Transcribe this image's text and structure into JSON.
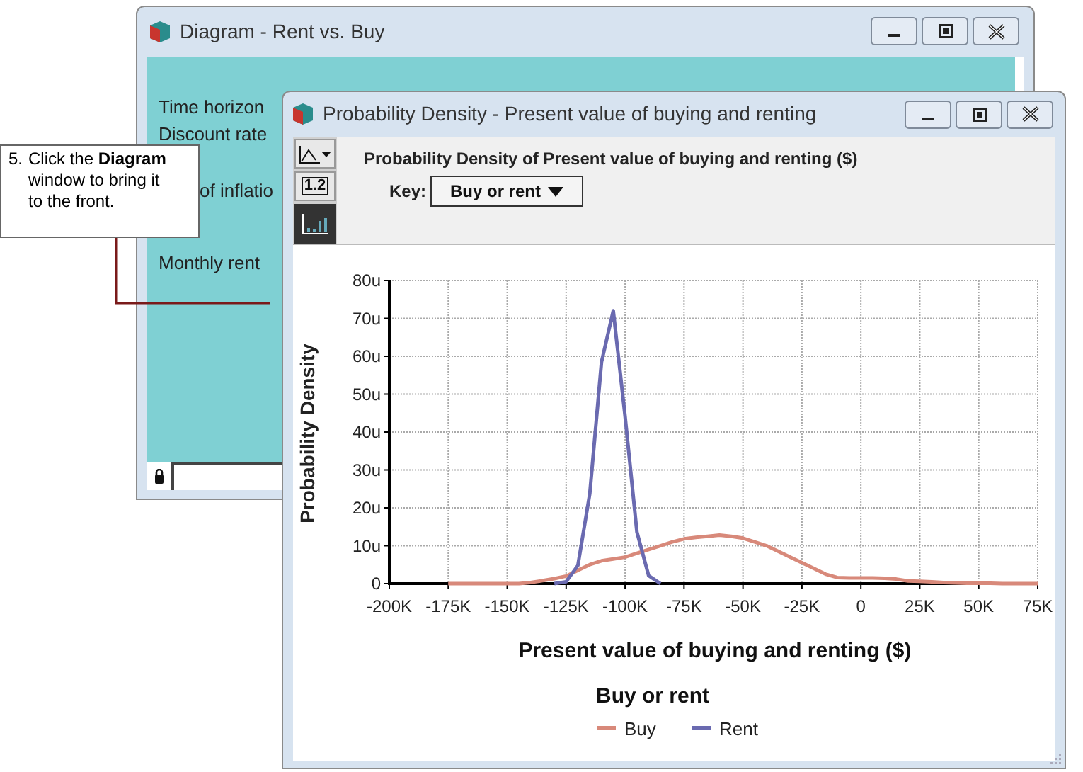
{
  "callout": {
    "number": "5.",
    "text": "Click the **Diagram** window to bring it to the front."
  },
  "back_window": {
    "title": "Diagram - Rent vs. Buy",
    "labels": [
      "Time horizon",
      "Discount rate",
      "of inflatio",
      "Monthly rent"
    ]
  },
  "front_window": {
    "title": "Probability Density - Present value of buying and renting",
    "toolbar": [
      {
        "kind": "chart-type",
        "selected": false
      },
      {
        "kind": "table",
        "label": "1.2",
        "selected": false
      },
      {
        "kind": "graph",
        "selected": true
      }
    ],
    "heading": "Probability Density of Present value of buying and renting ($)",
    "key_label": "Key:",
    "key_value": "Buy or rent",
    "legend_title": "Buy or rent",
    "chart_data": {
      "type": "line",
      "xlabel": "Present value of buying and renting ($)",
      "ylabel": "Probability Density",
      "x": [
        -175000,
        -170000,
        -165000,
        -160000,
        -155000,
        -150000,
        -145000,
        -140000,
        -135000,
        -130000,
        -125000,
        -120000,
        -115000,
        -110000,
        -105000,
        -100000,
        -95000,
        -90000,
        -85000,
        -80000,
        -75000,
        -70000,
        -65000,
        -60000,
        -55000,
        -50000,
        -45000,
        -40000,
        -35000,
        -30000,
        -25000,
        -20000,
        -15000,
        -10000,
        -5000,
        0,
        5000,
        10000,
        15000,
        20000,
        25000,
        30000,
        35000,
        40000,
        45000,
        50000,
        55000,
        60000,
        65000,
        70000,
        75000
      ],
      "series": [
        {
          "name": "Buy",
          "color": "#d8897a",
          "values": [
            0,
            0,
            0,
            0,
            0,
            0,
            0,
            0.3,
            0.8,
            1.3,
            2,
            3.5,
            5,
            6,
            6.5,
            7,
            8,
            9,
            10,
            11,
            11.8,
            12.2,
            12.5,
            12.8,
            12.5,
            12,
            11,
            10,
            8.5,
            7,
            5.5,
            4,
            2.5,
            1.6,
            1.5,
            1.5,
            1.5,
            1.4,
            1.2,
            0.7,
            0.6,
            0.5,
            0.3,
            0.2,
            0.1,
            0.1,
            0.1,
            0,
            0,
            0,
            0
          ]
        },
        {
          "name": "Rent",
          "color": "#6a6ab0",
          "values": [
            null,
            null,
            null,
            null,
            null,
            null,
            null,
            null,
            null,
            0,
            0.5,
            4.8,
            23.7,
            58.5,
            72,
            44.3,
            13.6,
            2.1,
            0,
            null,
            null,
            null,
            null,
            null,
            null,
            null,
            null,
            null,
            null,
            null,
            null,
            null,
            null,
            null,
            null,
            null,
            null,
            null,
            null,
            null,
            null,
            null,
            null,
            null,
            null,
            null,
            null,
            null,
            null,
            null,
            null
          ]
        }
      ],
      "grid": true,
      "legend": true,
      "xlim": [
        -200000,
        75000
      ],
      "ylim": [
        0,
        80
      ],
      "xticks": [
        {
          "value": -200000,
          "label": "-200K"
        },
        {
          "value": -175000,
          "label": "-175K"
        },
        {
          "value": -150000,
          "label": "-150K"
        },
        {
          "value": -125000,
          "label": "-125K"
        },
        {
          "value": -100000,
          "label": "-100K"
        },
        {
          "value": -75000,
          "label": "-75K"
        },
        {
          "value": -50000,
          "label": "-50K"
        },
        {
          "value": -25000,
          "label": "-25K"
        },
        {
          "value": 0,
          "label": "0"
        },
        {
          "value": 25000,
          "label": "25K"
        },
        {
          "value": 50000,
          "label": "50K"
        },
        {
          "value": 75000,
          "label": "75K"
        }
      ],
      "yticks": [
        {
          "value": 0,
          "label": "0"
        },
        {
          "value": 10,
          "label": "10u"
        },
        {
          "value": 20,
          "label": "20u"
        },
        {
          "value": 30,
          "label": "30u"
        },
        {
          "value": 40,
          "label": "40u"
        },
        {
          "value": 50,
          "label": "50u"
        },
        {
          "value": 60,
          "label": "60u"
        },
        {
          "value": 70,
          "label": "70u"
        },
        {
          "value": 80,
          "label": "80u"
        }
      ]
    }
  }
}
